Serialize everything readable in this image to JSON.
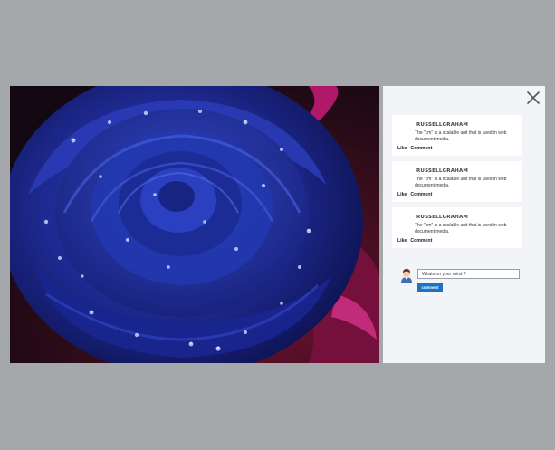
{
  "modal": {
    "close_icon": "close-icon",
    "photo": {
      "subject": "blue-rose-photo",
      "accent_color": "#1f2a9c"
    },
    "comments": [
      {
        "author": "RUSSELLGRAHAM",
        "text": "The \"cm\" is a scalable unit that is used in web document media.",
        "like_label": "Like",
        "comment_label": "Comment"
      },
      {
        "author": "RUSSELLGRAHAM",
        "text": "The \"cm\" is a scalable unit that is used in web document media.",
        "like_label": "Like",
        "comment_label": "Comment"
      },
      {
        "author": "RUSSELLGRAHAM",
        "text": "The \"cm\" is a scalable unit that is used in web document media.",
        "like_label": "Like",
        "comment_label": "Comment"
      }
    ],
    "composer": {
      "avatar_icon": "user-avatar-icon",
      "placeholder": "Whats on your mind ?",
      "value": "",
      "submit_label": "comment",
      "button_color": "#1b73c4"
    }
  }
}
